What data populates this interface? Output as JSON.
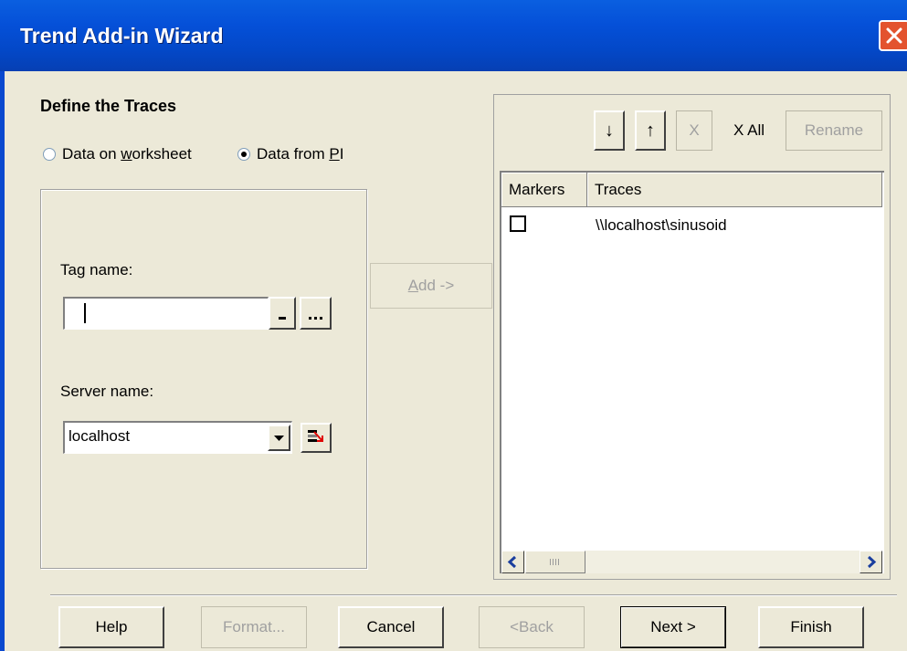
{
  "window": {
    "title": "Trend Add-in Wizard"
  },
  "page": {
    "heading": "Define the Traces"
  },
  "source": {
    "option_worksheet": {
      "pre": "Data on ",
      "key": "w",
      "post": "orksheet",
      "selected": false
    },
    "option_pi": {
      "pre": "Data from ",
      "key": "P",
      "post": "I",
      "selected": true
    }
  },
  "tag": {
    "label": "Tag name:",
    "value": ""
  },
  "server": {
    "label": "Server name:",
    "value": "localhost"
  },
  "add": {
    "pre": "",
    "key": "A",
    "post": "dd ->"
  },
  "toolbar": {
    "down_label": "↓",
    "up_label": "↑",
    "remove_label": "X",
    "remove_all_label": "X All",
    "rename_label": "Rename"
  },
  "list": {
    "columns": [
      "Markers",
      "Traces"
    ],
    "rows": [
      {
        "marker_checked": false,
        "trace": "\\\\localhost\\sinusoid"
      }
    ]
  },
  "buttons": {
    "help": "Help",
    "format": "Format...",
    "cancel": "Cancel",
    "back": "<Back",
    "next": "Next >",
    "finish": "Finish"
  },
  "colors": {
    "titlebar": "#0550d8",
    "face": "#ece9d8",
    "close": "#e3532e"
  }
}
